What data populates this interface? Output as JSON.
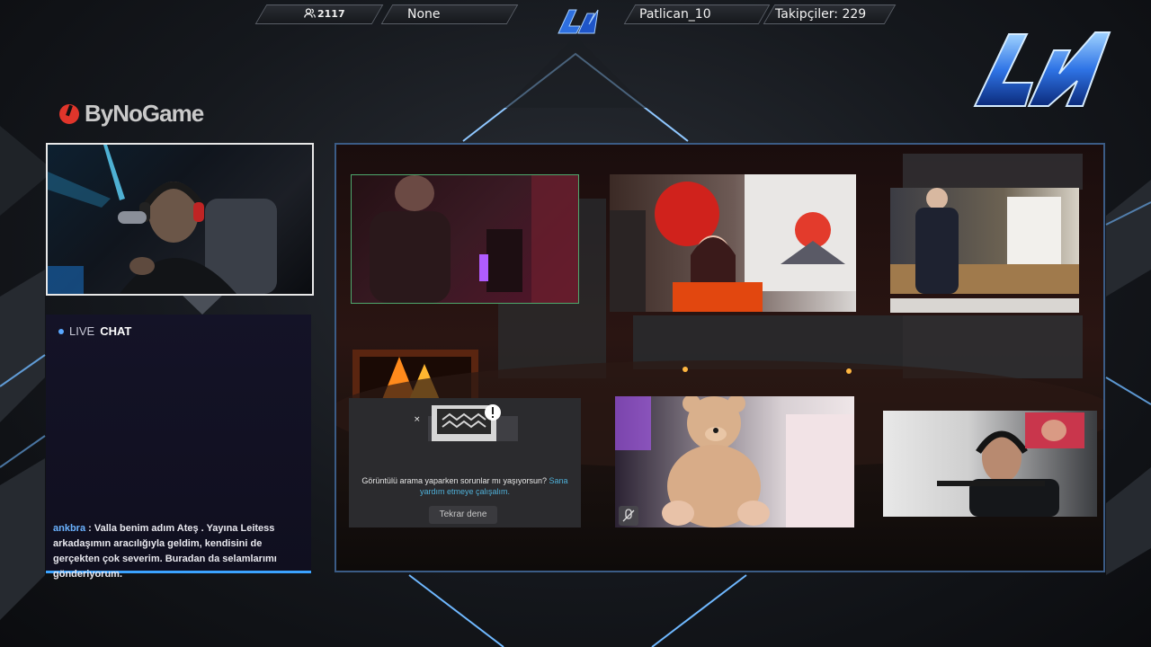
{
  "topbar": {
    "viewers": "2117",
    "game": "None",
    "streamer": "Patlican_10",
    "followers": "Takipçiler: 229"
  },
  "brand": {
    "name": "ByNoGame"
  },
  "chat": {
    "live_label": "LIVE",
    "chat_label": "CHAT",
    "messages": [
      {
        "user": "ankbra",
        "text": " : Valla benim adım Ateş . Yayına Leitess arkadaşımın aracılığıyla geldim, kendisini de gerçekten çok severim. Buradan da selamlarımı gönderiyorum."
      }
    ]
  },
  "call": {
    "error_text": "Görüntülü arama yaparken sorunlar mı yaşıyorsun?",
    "help_link": "Sana yardım etmeye çalışalım.",
    "retry_label": "Tekrar dene"
  },
  "colors": {
    "accent": "#3ba3ff",
    "chat_user": "#6ab2ff",
    "link": "#4fb0d8"
  },
  "icons": [
    "users-icon",
    "alert-icon",
    "mic-off-icon",
    "bynogame-logo-icon"
  ]
}
